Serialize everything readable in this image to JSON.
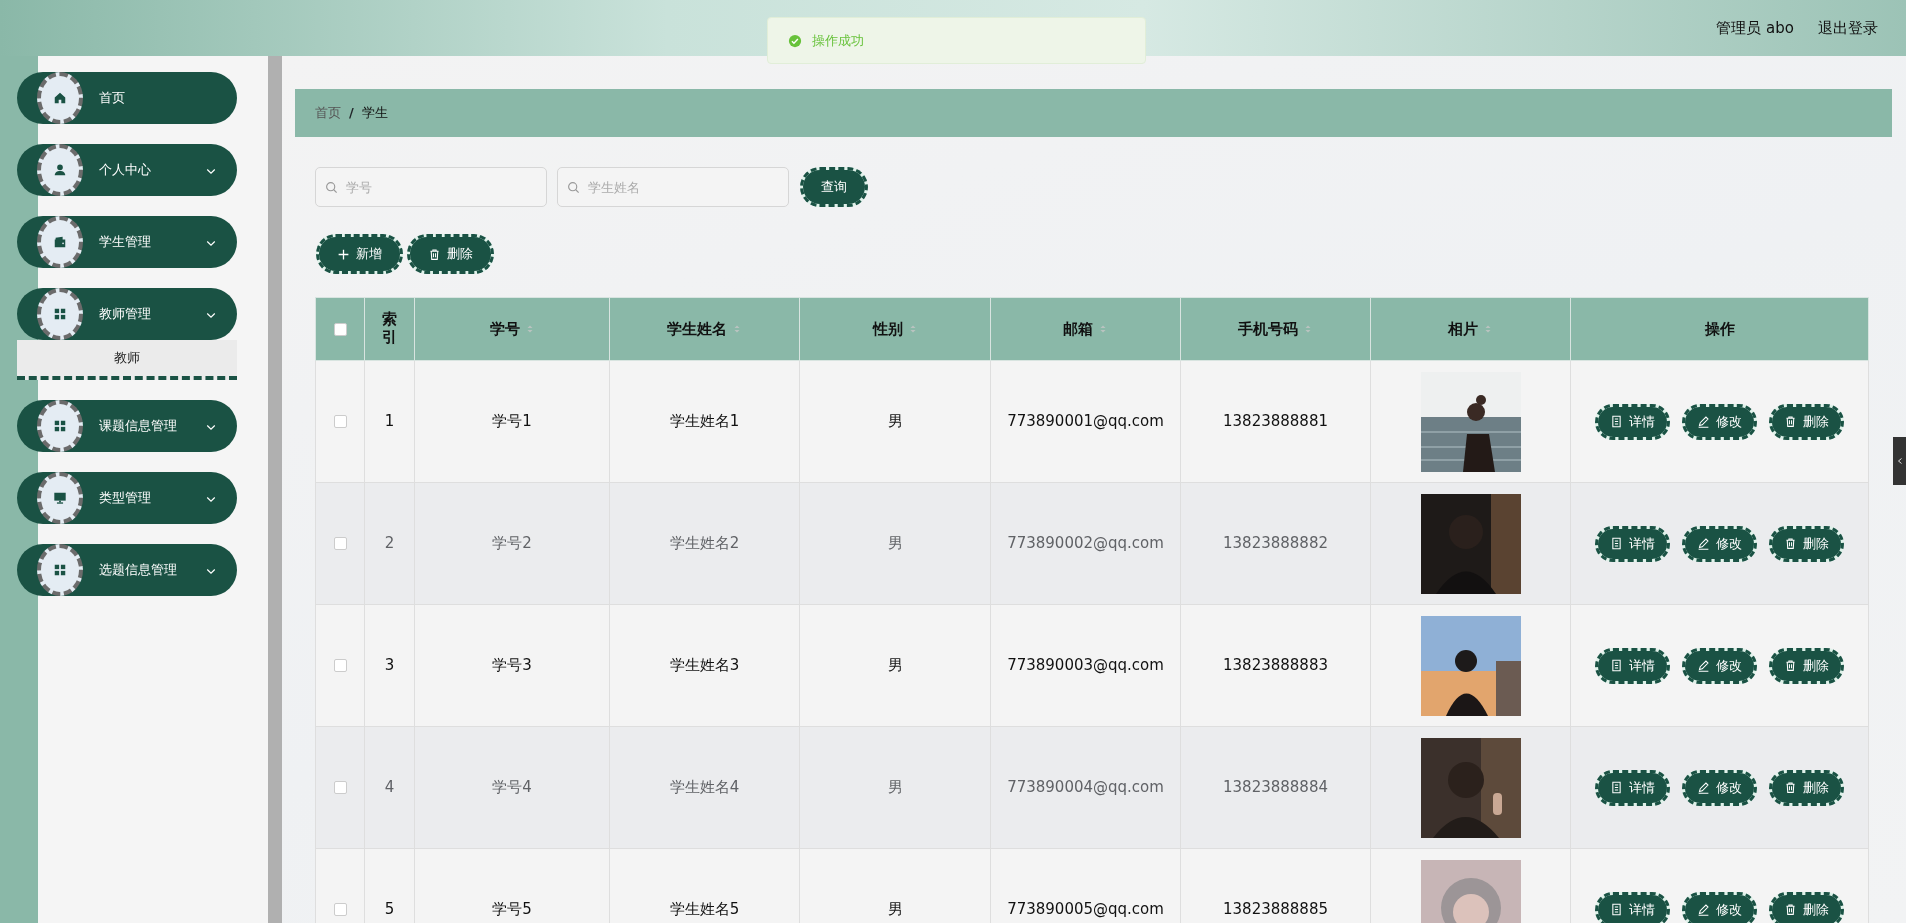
{
  "header": {
    "user": "管理员 abo",
    "logout": "退出登录"
  },
  "toast": {
    "kind": "success",
    "message": "操作成功"
  },
  "sidebar": {
    "items": [
      {
        "kind": "home",
        "label": "首页"
      },
      {
        "kind": "user",
        "label": "个人中心",
        "has_submenu": true
      },
      {
        "kind": "wallet",
        "label": "学生管理",
        "has_submenu": true
      },
      {
        "kind": "grid",
        "label": "教师管理",
        "has_submenu": true,
        "children": [
          {
            "label": "教师"
          }
        ]
      },
      {
        "kind": "grid",
        "label": "课题信息管理",
        "has_submenu": true
      },
      {
        "kind": "monitor",
        "label": "类型管理",
        "has_submenu": true
      },
      {
        "kind": "grid",
        "label": "选题信息管理",
        "has_submenu": true
      }
    ]
  },
  "breadcrumb": {
    "items": [
      "首页",
      "学生"
    ],
    "separator": "/"
  },
  "search": {
    "fields": [
      {
        "placeholder": "学号"
      },
      {
        "placeholder": "学生姓名"
      }
    ],
    "button": "查询"
  },
  "toolbar": [
    {
      "kind": "add",
      "label": "新增"
    },
    {
      "kind": "delete",
      "label": "删除"
    }
  ],
  "table": {
    "header_checked": false,
    "columns": [
      {
        "label": "索引",
        "sortable": false
      },
      {
        "label": "学号",
        "sortable": true
      },
      {
        "label": "学生姓名",
        "sortable": true
      },
      {
        "label": "性别",
        "sortable": true
      },
      {
        "label": "邮箱",
        "sortable": true
      },
      {
        "label": "手机号码",
        "sortable": true
      },
      {
        "label": "相片",
        "sortable": true
      },
      {
        "label": "操作",
        "sortable": false
      }
    ],
    "rows": [
      {
        "checked": false,
        "index": "1",
        "student_no": "学号1",
        "name": "学生姓名1",
        "gender": "男",
        "email": "773890001@qq.com",
        "phone": "13823888881",
        "actions": [
          {
            "kind": "detail",
            "label": "详情"
          },
          {
            "kind": "edit",
            "label": "修改"
          },
          {
            "kind": "delete",
            "label": "删除"
          }
        ]
      },
      {
        "checked": false,
        "index": "2",
        "student_no": "学号2",
        "name": "学生姓名2",
        "gender": "男",
        "email": "773890002@qq.com",
        "phone": "13823888882",
        "actions": [
          {
            "kind": "detail",
            "label": "详情"
          },
          {
            "kind": "edit",
            "label": "修改"
          },
          {
            "kind": "delete",
            "label": "删除"
          }
        ]
      },
      {
        "checked": false,
        "index": "3",
        "student_no": "学号3",
        "name": "学生姓名3",
        "gender": "男",
        "email": "773890003@qq.com",
        "phone": "13823888883",
        "actions": [
          {
            "kind": "detail",
            "label": "详情"
          },
          {
            "kind": "edit",
            "label": "修改"
          },
          {
            "kind": "delete",
            "label": "删除"
          }
        ]
      },
      {
        "checked": false,
        "index": "4",
        "student_no": "学号4",
        "name": "学生姓名4",
        "gender": "男",
        "email": "773890004@qq.com",
        "phone": "13823888884",
        "actions": [
          {
            "kind": "detail",
            "label": "详情"
          },
          {
            "kind": "edit",
            "label": "修改"
          },
          {
            "kind": "delete",
            "label": "删除"
          }
        ]
      },
      {
        "checked": false,
        "index": "5",
        "student_no": "学号5",
        "name": "学生姓名5",
        "gender": "男",
        "email": "773890005@qq.com",
        "phone": "13823888885",
        "actions": [
          {
            "kind": "detail",
            "label": "详情"
          },
          {
            "kind": "edit",
            "label": "修改"
          },
          {
            "kind": "delete",
            "label": "删除"
          }
        ]
      }
    ]
  }
}
